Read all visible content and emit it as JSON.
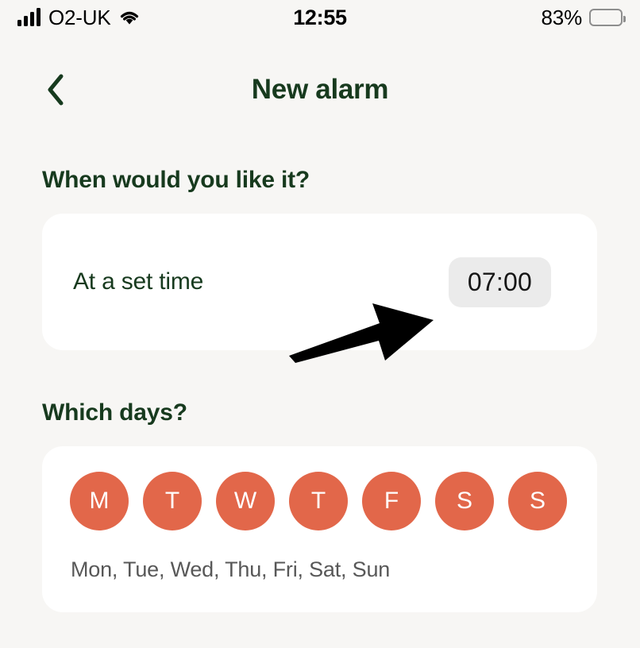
{
  "status_bar": {
    "carrier": "O2-UK",
    "time": "12:55",
    "battery_percent": "83%",
    "battery_level": 83,
    "signal_icon": "signal-bars-icon",
    "wifi_icon": "wifi-icon",
    "battery_icon": "battery-icon"
  },
  "nav": {
    "back_icon": "chevron-left-icon",
    "title": "New alarm"
  },
  "sections": {
    "when": {
      "heading": "When would you like it?",
      "row_label": "At a set time",
      "time_value": "07:00"
    },
    "days": {
      "heading": "Which days?",
      "items": [
        {
          "letter": "M",
          "name": "Mon",
          "selected": true
        },
        {
          "letter": "T",
          "name": "Tue",
          "selected": true
        },
        {
          "letter": "W",
          "name": "Wed",
          "selected": true
        },
        {
          "letter": "T",
          "name": "Thu",
          "selected": true
        },
        {
          "letter": "F",
          "name": "Fri",
          "selected": true
        },
        {
          "letter": "S",
          "name": "Sat",
          "selected": true
        },
        {
          "letter": "S",
          "name": "Sun",
          "selected": true
        }
      ],
      "summary": "Mon, Tue, Wed, Thu, Fri, Sat, Sun"
    }
  },
  "annotation": {
    "arrow_icon": "arrow-pointer-icon",
    "arrow_color": "#000000"
  },
  "colors": {
    "page_background": "#f7f6f4",
    "card_background": "#ffffff",
    "brand_green": "#173a1e",
    "accent_orange": "#e2674a",
    "pill_grey": "#ebebeb",
    "muted_text": "#585858"
  }
}
